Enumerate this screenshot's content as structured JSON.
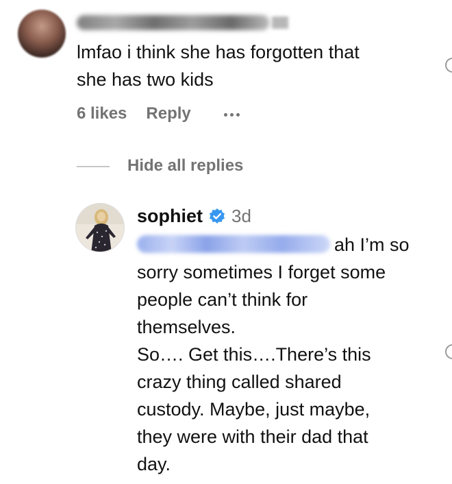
{
  "comment": {
    "text_lines": [
      "lmfao i think she has forgotten that",
      "she has two kids"
    ],
    "likes": "6 likes",
    "reply_label": "Reply",
    "more_icon": "more-dots-icon"
  },
  "thread": {
    "hide_replies_label": "Hide all replies"
  },
  "reply": {
    "username": "sophiet",
    "verified_icon": "verified-badge-icon",
    "time": "3d",
    "first_line": "ah I’m so",
    "body_lines": [
      "sorry sometimes I forget some",
      "people can’t think for",
      "themselves.",
      "So…. Get this….There’s this",
      "crazy thing called shared",
      "custody. Maybe, just maybe,",
      "they were with their dad that",
      "day."
    ]
  },
  "colors": {
    "text": "#111111",
    "secondary": "#737373",
    "verified_blue": "#3897f0",
    "mention_blue": "#8fa8ec"
  }
}
